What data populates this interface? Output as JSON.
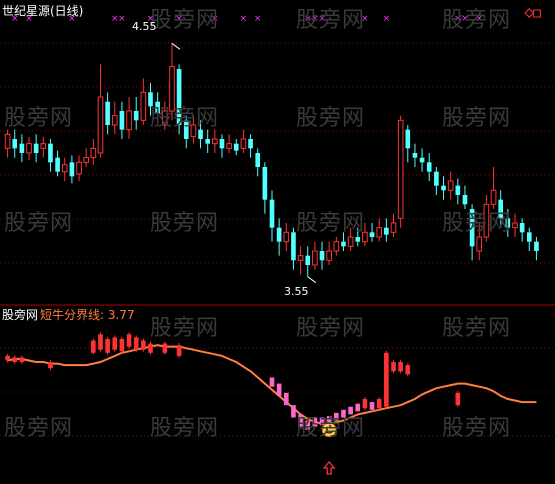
{
  "top_panel": {
    "title": "世纪星源(日线)",
    "high_label": "4.55",
    "low_label": "3.55"
  },
  "bottom_panel": {
    "site_label": "股旁网",
    "indicator_label": "短牛分界线: 3.77"
  },
  "watermark_text": "股旁网",
  "colors": {
    "up": "#ff3333",
    "down": "#54ffff",
    "grid": "#8b0000",
    "line": "#ff7f3f",
    "marker": "#ff33ff",
    "pink": "#ff66cc",
    "arrow": "#ff3333",
    "smiley": "#ffd24a",
    "title": "#ffffff",
    "indicator_text": "#ff7f3f"
  },
  "icons": [
    "diamond-icon",
    "square-icon",
    "smiley-icon",
    "up-arrow-icon"
  ],
  "chart_data": [
    {
      "type": "candlestick",
      "title": "世纪星源(日线)",
      "annotations": [
        {
          "text": "4.55",
          "kind": "high"
        },
        {
          "text": "3.55",
          "kind": "low"
        }
      ],
      "ylim": [
        3.45,
        4.65
      ],
      "candles": [
        [
          4.1,
          4.16,
          4.18,
          4.06
        ],
        [
          4.14,
          4.1,
          4.18,
          4.06
        ],
        [
          4.12,
          4.08,
          4.16,
          4.04
        ],
        [
          4.08,
          4.12,
          4.15,
          4.05
        ],
        [
          4.12,
          4.08,
          4.16,
          4.04
        ],
        [
          4.1,
          4.12,
          4.15,
          4.06
        ],
        [
          4.12,
          4.04,
          4.14,
          4.0
        ],
        [
          4.06,
          4.0,
          4.09,
          3.98
        ],
        [
          4.0,
          4.03,
          4.06,
          3.96
        ],
        [
          4.04,
          3.98,
          4.07,
          3.95
        ],
        [
          3.99,
          4.04,
          4.07,
          3.96
        ],
        [
          4.04,
          4.06,
          4.1,
          4.02
        ],
        [
          4.06,
          4.1,
          4.14,
          4.03
        ],
        [
          4.08,
          4.32,
          4.46,
          4.06
        ],
        [
          4.3,
          4.2,
          4.34,
          4.16
        ],
        [
          4.2,
          4.24,
          4.3,
          4.16
        ],
        [
          4.26,
          4.18,
          4.3,
          4.14
        ],
        [
          4.18,
          4.26,
          4.32,
          4.14
        ],
        [
          4.26,
          4.22,
          4.32,
          4.18
        ],
        [
          4.22,
          4.34,
          4.4,
          4.2
        ],
        [
          4.34,
          4.28,
          4.38,
          4.24
        ],
        [
          4.3,
          4.25,
          4.34,
          4.22
        ],
        [
          4.2,
          4.26,
          4.3,
          4.18
        ],
        [
          4.26,
          4.45,
          4.55,
          4.22
        ],
        [
          4.44,
          4.2,
          4.46,
          4.16
        ],
        [
          4.22,
          4.14,
          4.24,
          4.1
        ],
        [
          4.15,
          4.2,
          4.24,
          4.12
        ],
        [
          4.18,
          4.14,
          4.22,
          4.1
        ],
        [
          4.14,
          4.12,
          4.18,
          4.08
        ],
        [
          4.12,
          4.14,
          4.18,
          4.08
        ],
        [
          4.14,
          4.1,
          4.16,
          4.06
        ],
        [
          4.1,
          4.12,
          4.16,
          4.08
        ],
        [
          4.12,
          4.09,
          4.14,
          4.07
        ],
        [
          4.1,
          4.14,
          4.18,
          4.08
        ],
        [
          4.14,
          4.1,
          4.16,
          4.06
        ],
        [
          4.08,
          4.02,
          4.1,
          3.98
        ],
        [
          4.02,
          3.88,
          4.04,
          3.82
        ],
        [
          3.88,
          3.76,
          3.92,
          3.7
        ],
        [
          3.76,
          3.7,
          3.8,
          3.64
        ],
        [
          3.7,
          3.74,
          3.78,
          3.66
        ],
        [
          3.74,
          3.62,
          3.76,
          3.58
        ],
        [
          3.62,
          3.64,
          3.68,
          3.56
        ],
        [
          3.64,
          3.6,
          3.68,
          3.55
        ],
        [
          3.6,
          3.66,
          3.7,
          3.58
        ],
        [
          3.66,
          3.62,
          3.7,
          3.58
        ],
        [
          3.62,
          3.66,
          3.7,
          3.6
        ],
        [
          3.66,
          3.7,
          3.72,
          3.64
        ],
        [
          3.7,
          3.68,
          3.74,
          3.66
        ],
        [
          3.68,
          3.72,
          3.76,
          3.66
        ],
        [
          3.72,
          3.7,
          3.76,
          3.68
        ],
        [
          3.7,
          3.74,
          3.78,
          3.68
        ],
        [
          3.74,
          3.72,
          3.78,
          3.7
        ],
        [
          3.72,
          3.76,
          3.8,
          3.7
        ],
        [
          3.76,
          3.73,
          3.8,
          3.7
        ],
        [
          3.74,
          3.78,
          3.82,
          3.72
        ],
        [
          3.8,
          4.22,
          4.24,
          3.76
        ],
        [
          4.18,
          4.1,
          4.2,
          4.04
        ],
        [
          4.08,
          4.06,
          4.12,
          4.02
        ],
        [
          4.06,
          4.04,
          4.1,
          4.0
        ],
        [
          4.04,
          4.0,
          4.08,
          3.96
        ],
        [
          4.0,
          3.94,
          4.02,
          3.9
        ],
        [
          3.94,
          3.92,
          3.98,
          3.88
        ],
        [
          3.92,
          3.96,
          4.0,
          3.88
        ],
        [
          3.94,
          3.9,
          3.97,
          3.86
        ],
        [
          3.9,
          3.86,
          3.94,
          3.84
        ],
        [
          3.84,
          3.68,
          3.86,
          3.62
        ],
        [
          3.66,
          3.72,
          3.78,
          3.62
        ],
        [
          3.72,
          3.86,
          3.9,
          3.7
        ],
        [
          3.86,
          3.92,
          4.02,
          3.84
        ],
        [
          3.88,
          3.8,
          3.92,
          3.76
        ],
        [
          3.8,
          3.76,
          3.84,
          3.72
        ],
        [
          3.76,
          3.78,
          3.82,
          3.72
        ],
        [
          3.78,
          3.74,
          3.8,
          3.7
        ],
        [
          3.74,
          3.7,
          3.76,
          3.66
        ],
        [
          3.7,
          3.66,
          3.72,
          3.62
        ]
      ],
      "markers": [
        {
          "index": 1,
          "kind": "cross"
        },
        {
          "index": 3,
          "kind": "cross"
        },
        {
          "index": 9,
          "kind": "cross"
        },
        {
          "index": 15,
          "kind": "cross"
        },
        {
          "index": 16,
          "kind": "cross"
        },
        {
          "index": 20,
          "kind": "cross"
        },
        {
          "index": 24,
          "kind": "cross"
        },
        {
          "index": 29,
          "kind": "cross"
        },
        {
          "index": 33,
          "kind": "cross"
        },
        {
          "index": 35,
          "kind": "cross"
        },
        {
          "index": 42,
          "kind": "cross"
        },
        {
          "index": 43,
          "kind": "cross"
        },
        {
          "index": 44,
          "kind": "cross"
        },
        {
          "index": 50,
          "kind": "cross"
        },
        {
          "index": 53,
          "kind": "cross"
        },
        {
          "index": 63,
          "kind": "cross"
        },
        {
          "index": 64,
          "kind": "cross"
        },
        {
          "index": 66,
          "kind": "cross"
        },
        {
          "index": 73,
          "kind": "diamond"
        },
        {
          "index": 74,
          "kind": "square"
        }
      ]
    },
    {
      "type": "indicator",
      "title": "短牛分界线: 3.77",
      "ylim": [
        0,
        100
      ],
      "line_value": [
        75,
        76,
        76,
        75,
        74,
        74,
        73,
        73,
        72,
        72,
        72,
        72,
        73,
        74,
        76,
        78,
        80,
        81,
        82,
        83,
        84,
        85,
        84,
        84,
        84,
        83,
        82,
        81,
        80,
        79,
        78,
        76,
        74,
        71,
        68,
        64,
        60,
        56,
        52,
        48,
        44,
        40,
        37,
        35,
        34,
        34,
        35,
        36,
        38,
        40,
        41,
        42,
        43,
        44,
        45,
        46,
        48,
        50,
        53,
        55,
        57,
        58,
        59,
        60,
        60,
        59,
        58,
        57,
        55,
        52,
        50,
        49,
        48,
        48,
        48
      ],
      "red_bars_top": [
        {
          "index": 0,
          "low": 75,
          "high": 78
        },
        {
          "index": 1,
          "low": 74,
          "high": 77
        },
        {
          "index": 2,
          "low": 74,
          "high": 77
        },
        {
          "index": 6,
          "low": 70,
          "high": 74
        },
        {
          "index": 12,
          "low": 80,
          "high": 88
        },
        {
          "index": 13,
          "low": 82,
          "high": 92
        },
        {
          "index": 14,
          "low": 80,
          "high": 89
        },
        {
          "index": 15,
          "low": 82,
          "high": 90
        },
        {
          "index": 16,
          "low": 81,
          "high": 89
        },
        {
          "index": 17,
          "low": 84,
          "high": 92
        },
        {
          "index": 18,
          "low": 82,
          "high": 90
        },
        {
          "index": 19,
          "low": 82,
          "high": 88
        },
        {
          "index": 20,
          "low": 80,
          "high": 86
        },
        {
          "index": 22,
          "low": 80,
          "high": 86
        },
        {
          "index": 24,
          "low": 78,
          "high": 85
        },
        {
          "index": 50,
          "low": 44,
          "high": 50
        },
        {
          "index": 52,
          "low": 44,
          "high": 50
        },
        {
          "index": 53,
          "low": 45,
          "high": 80
        },
        {
          "index": 54,
          "low": 68,
          "high": 74
        },
        {
          "index": 55,
          "low": 68,
          "high": 74
        },
        {
          "index": 56,
          "low": 66,
          "high": 72
        },
        {
          "index": 63,
          "low": 46,
          "high": 54
        }
      ],
      "pink_bars": [
        {
          "index": 37,
          "low": 58,
          "high": 64
        },
        {
          "index": 38,
          "low": 52,
          "high": 60
        },
        {
          "index": 39,
          "low": 46,
          "high": 54
        },
        {
          "index": 40,
          "low": 38,
          "high": 46
        },
        {
          "index": 41,
          "low": 32,
          "high": 40
        },
        {
          "index": 42,
          "low": 30,
          "high": 36
        },
        {
          "index": 43,
          "low": 32,
          "high": 38
        },
        {
          "index": 44,
          "low": 33,
          "high": 38
        },
        {
          "index": 45,
          "low": 34,
          "high": 39
        },
        {
          "index": 46,
          "low": 36,
          "high": 41
        },
        {
          "index": 47,
          "low": 38,
          "high": 43
        },
        {
          "index": 48,
          "low": 40,
          "high": 45
        },
        {
          "index": 49,
          "low": 42,
          "high": 47
        },
        {
          "index": 51,
          "low": 43,
          "high": 48
        }
      ],
      "signal": {
        "index": 45,
        "kind": "smiley-with-up-arrow"
      }
    }
  ]
}
